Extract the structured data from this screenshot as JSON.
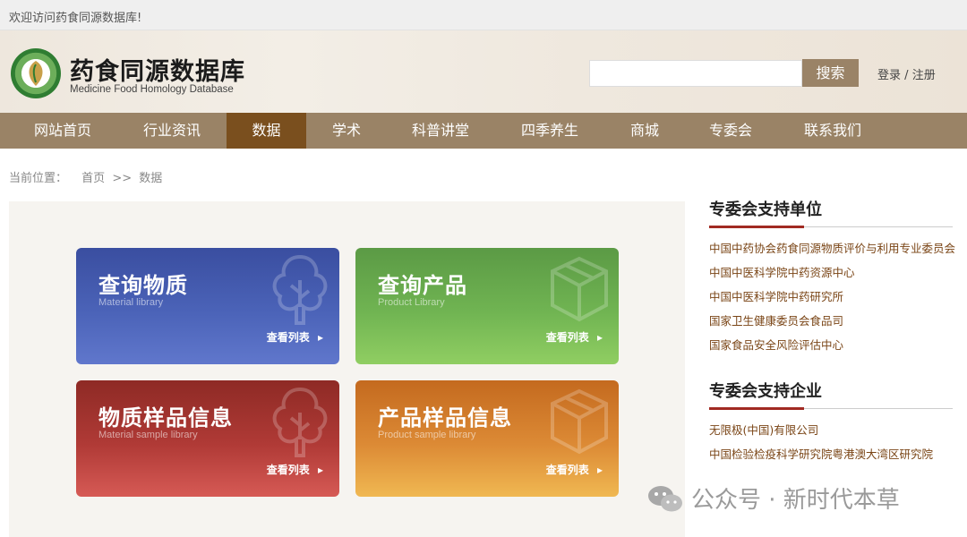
{
  "topbar": {
    "welcome": "欢迎访问药食同源数据库!"
  },
  "header": {
    "title": "药食同源数据库",
    "subtitle": "Medicine Food Homology Database",
    "search_placeholder": "",
    "search_button": "搜索",
    "login": "登录",
    "separator": "/",
    "register": "注册"
  },
  "nav": {
    "items": [
      {
        "label": "网站首页"
      },
      {
        "label": "行业资讯"
      },
      {
        "label": "数据",
        "active": true
      },
      {
        "label": "学术"
      },
      {
        "label": "科普讲堂"
      },
      {
        "label": "四季养生"
      },
      {
        "label": "商城"
      },
      {
        "label": "专委会"
      },
      {
        "label": "联系我们"
      }
    ]
  },
  "breadcrumb": {
    "prefix": "当前位置：",
    "home": "首页",
    "sep": ">>",
    "current": "数据"
  },
  "cards": [
    {
      "title": "查询物质",
      "subtitle": "Material library",
      "link": "查看列表",
      "icon": "tree-icon",
      "color": "#4b63b8"
    },
    {
      "title": "查询产品",
      "subtitle": "Product Library",
      "link": "查看列表",
      "icon": "box-icon",
      "color": "#70b452"
    },
    {
      "title": "物质样品信息",
      "subtitle": "Material sample library",
      "link": "查看列表",
      "icon": "tree-icon",
      "color": "#b03a36"
    },
    {
      "title": "产品样品信息",
      "subtitle": "Product sample library",
      "link": "查看列表",
      "icon": "box-icon",
      "color": "#dc8a35"
    }
  ],
  "sidebar": {
    "support_units": {
      "title": "专委会支持单位",
      "items": [
        "中国中药协会药食同源物质评价与利用专业委员会",
        "中国中医科学院中药资源中心",
        "中国中医科学院中药研究所",
        "国家卫生健康委员会食品司",
        "国家食品安全风险评估中心"
      ]
    },
    "support_companies": {
      "title": "专委会支持企业",
      "items": [
        "无限极(中国)有限公司",
        "中国检验检疫科学研究院粤港澳大湾区研究院"
      ]
    }
  },
  "watermark": {
    "text": "公众号 · 新时代本草"
  },
  "colors": {
    "nav_bg": "#9a8366",
    "nav_active": "#7a4f1e",
    "accent_red": "#a12a22",
    "link_brown": "#7a4516"
  }
}
